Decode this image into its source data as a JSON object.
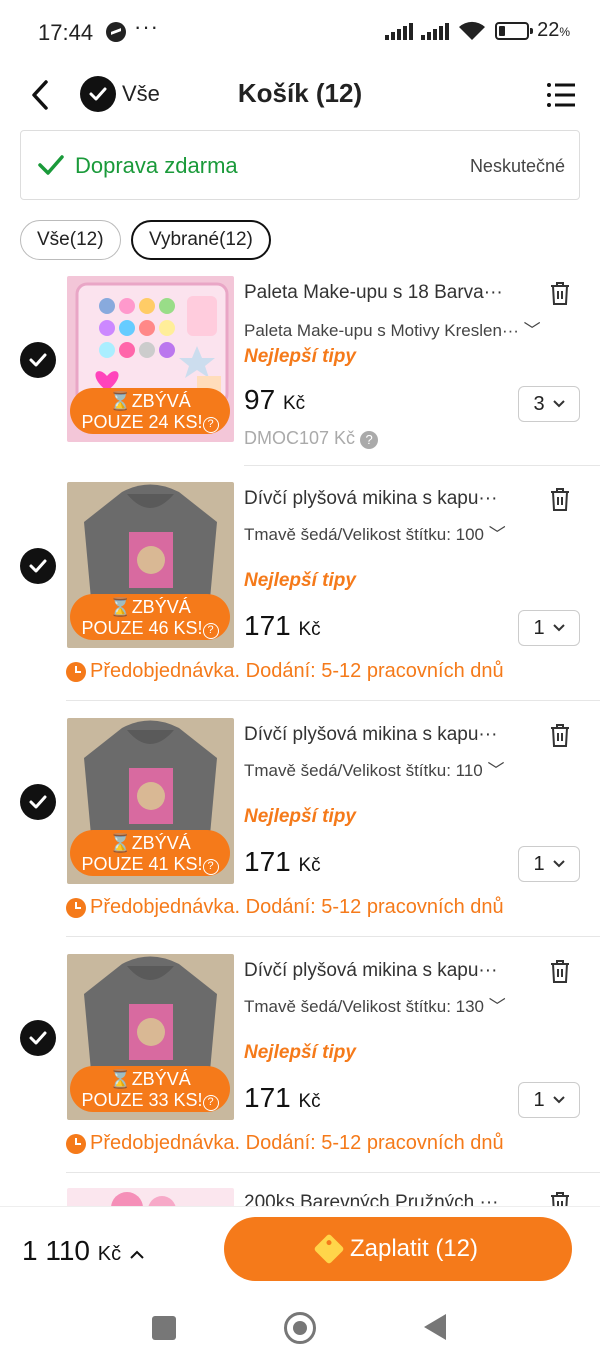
{
  "status_bar": {
    "time": "17:44",
    "dots": "···",
    "battery_pct": "22",
    "battery_unit": "%"
  },
  "header": {
    "select_all_label": "Vše",
    "title": "Košík (12)"
  },
  "shipping": {
    "label": "Doprava zdarma",
    "right_text": "Neskutečné"
  },
  "filters": {
    "all": "Vše(12)",
    "selected": "Vybrané(12)"
  },
  "items": [
    {
      "name": "Paleta Make-upu s 18 Barva···",
      "variant": "Paleta Make-upu s Motivy Kreslen···",
      "tip": "Nejlepší tipy",
      "price": "97",
      "currency": "Kč",
      "qty": "3",
      "badge_line1": "ZBÝVÁ",
      "badge_line2": "POUZE 24 KS!",
      "orig_price": "DMOC107 Kč"
    },
    {
      "name": "Dívčí plyšová mikina s kapu···",
      "variant": "Tmavě šedá/Velikost štítku: 100",
      "tip": "Nejlepší tipy",
      "price": "171",
      "currency": "Kč",
      "qty": "1",
      "badge_line1": "ZBÝVÁ",
      "badge_line2": "POUZE 46 KS!",
      "preorder": "Předobjednávka. Dodání: 5-12 pracovních dnů"
    },
    {
      "name": "Dívčí plyšová mikina s kapu···",
      "variant": "Tmavě šedá/Velikost štítku: 110",
      "tip": "Nejlepší tipy",
      "price": "171",
      "currency": "Kč",
      "qty": "1",
      "badge_line1": "ZBÝVÁ",
      "badge_line2": "POUZE 41 KS!",
      "preorder": "Předobjednávka. Dodání: 5-12 pracovních dnů"
    },
    {
      "name": "Dívčí plyšová mikina s kapu···",
      "variant": "Tmavě šedá/Velikost štítku: 130",
      "tip": "Nejlepší tipy",
      "price": "171",
      "currency": "Kč",
      "qty": "1",
      "badge_line1": "ZBÝVÁ",
      "badge_line2": "POUZE 33 KS!",
      "preorder": "Předobjednávka. Dodání: 5-12 pracovních dnů"
    },
    {
      "name": "200ks Barevných Pružných ···"
    }
  ],
  "bottom": {
    "total": "1 110",
    "currency": "Kč",
    "pay_label": "Zaplatit (12)"
  },
  "colors": {
    "accent": "#f57a1a",
    "success": "#1a9a3a"
  },
  "icons": [
    "back-icon",
    "check-icon",
    "list-menu-icon",
    "trash-icon",
    "chevron-down-icon",
    "clock-icon",
    "hourglass-icon",
    "help-icon",
    "tag-icon"
  ]
}
